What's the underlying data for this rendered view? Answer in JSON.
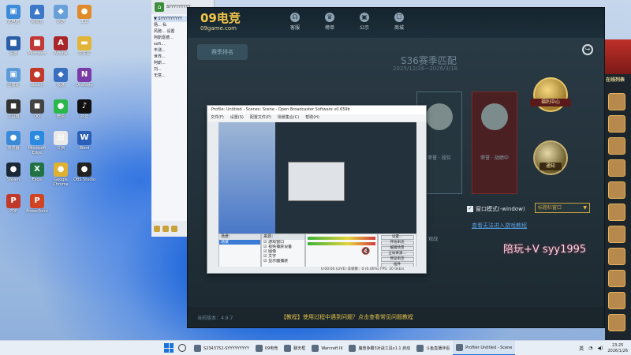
{
  "desktop": {
    "icons": [
      {
        "label": "此电脑",
        "color": "#3c8ad8",
        "glyph": "▣"
      },
      {
        "label": "网易云",
        "color": "#3c78c8",
        "glyph": "▲"
      },
      {
        "label": "驱动",
        "color": "#6aa0d8",
        "glyph": "◆"
      },
      {
        "label": "工具",
        "color": "#e08a2a",
        "glyph": "●"
      },
      {
        "label": "设置",
        "color": "#2a5fa8",
        "glyph": "■"
      },
      {
        "label": "Microsoft",
        "color": "#c03838",
        "glyph": "■"
      },
      {
        "label": "Access",
        "color": "#a8262a",
        "glyph": "A"
      },
      {
        "label": "文件夹",
        "color": "#e2b53a",
        "glyph": "▬"
      },
      {
        "label": "回收站",
        "color": "#5c9ad8",
        "glyph": "▣"
      },
      {
        "label": "Steam",
        "color": "#c0392b",
        "glyph": "●"
      },
      {
        "label": "极速",
        "color": "#3a6fc0",
        "glyph": "◆"
      },
      {
        "label": "OneNote",
        "color": "#7a3aa8",
        "glyph": "N"
      },
      {
        "label": "工具箱",
        "color": "#333333",
        "glyph": "◼"
      },
      {
        "label": "QQ",
        "color": "#444444",
        "glyph": "◼"
      },
      {
        "label": "微信",
        "color": "#2ab84a",
        "glyph": "●"
      },
      {
        "label": "抖音",
        "color": "#111111",
        "glyph": "♪"
      },
      {
        "label": "浏览器",
        "color": "#3a8ad8",
        "glyph": "●"
      },
      {
        "label": "Microsoft Edge",
        "color": "#2a8ae0",
        "glyph": "e"
      },
      {
        "label": "文档",
        "color": "#eaeaea",
        "glyph": "▤"
      },
      {
        "label": "Word",
        "color": "#2a5fb8",
        "glyph": "W"
      },
      {
        "label": "Steam",
        "color": "#1b2838",
        "glyph": "●"
      },
      {
        "label": "Excel",
        "color": "#217346",
        "glyph": "X"
      },
      {
        "label": "Google Chrome",
        "color": "#e0b030",
        "glyph": "●"
      },
      {
        "label": "OBS Studio",
        "color": "#222222",
        "glyph": "●"
      },
      {
        "label": "PDF",
        "color": "#c0392b",
        "glyph": "P"
      },
      {
        "label": "PowerPoint",
        "color": "#d04423",
        "glyph": "P"
      }
    ]
  },
  "chat": {
    "window_title": "SYYYYYYYYY",
    "items": [
      "▼ SYYYYYYYYY",
      "杨... 私",
      "风驰... 设置",
      "阿斯嘉德...",
      "soft...",
      "丰测...",
      "世界...",
      "阿斯...",
      "刘...",
      "无意..."
    ]
  },
  "game": {
    "logo": "09电竞",
    "logo_sub": "09game.com",
    "nav": [
      {
        "label": "客服",
        "icon": "headset-icon",
        "glyph": "☊"
      },
      {
        "label": "榜单",
        "icon": "trophy-icon",
        "glyph": "♛"
      },
      {
        "label": "公示",
        "icon": "notice-icon",
        "glyph": "▣"
      },
      {
        "label": "商城",
        "icon": "cart-icon",
        "glyph": "☐"
      }
    ],
    "season_badge": "赛季排名",
    "season_title": "S36赛季匹配",
    "season_date": "2025/12/26~2026/3/18",
    "welfare_label": "福利中心",
    "notice_label": "通知",
    "card_texts": [
      "荣誉 · 段位",
      "荣誉 · 战绩中"
    ],
    "window_mode": "窗口模式(-window)",
    "window_mode_checked": "✓",
    "window_select": "标题栏窗口",
    "tutorial_link": "查看无法进入游戏教程",
    "tab_watch": "观战",
    "version": "当前版本：4.9.7",
    "tutorial_banner": "【教程】使用过程中遇到问题？点击查看常见问题教程",
    "watermark": "陪玩+V syy1995"
  },
  "online": {
    "label": "在线列表"
  },
  "obs": {
    "title": "Profile: Untitled - Scenes: Scene - Open Broadcaster Software v0.659b",
    "menu": [
      "文件(F)",
      "设置(S)",
      "配置文件(P)",
      "场景集合(C)",
      "帮助(H)"
    ],
    "scenes_header": "场景：",
    "scenes": [
      "场景"
    ],
    "sources_header": "来源：",
    "sources": [
      "游戏窗口",
      "视频捕获设备",
      "图像",
      "文字",
      "显示器捕获"
    ],
    "buttons": [
      "设置...",
      "开始串流",
      "编辑场景",
      "全局来源...",
      "预览串流",
      "插件",
      "退出"
    ],
    "status": "0:00:00 (LIVE)   丢帧数：0 (0.00%)   FPS: 30   0kb/s"
  },
  "taskbar": {
    "items": [
      {
        "label": "S2343752-SYYYYYYYYY"
      },
      {
        "label": "09电竞"
      },
      {
        "label": "聊天框"
      },
      {
        "label": "Warcraft III"
      },
      {
        "label": "魔兽争霸3对战工具v1.1 启动"
      },
      {
        "label": "斗鱼直播伴侣"
      },
      {
        "label": "Profiler Untitled - Scene"
      }
    ],
    "lang": "英",
    "time": "23:25",
    "date": "2026/1/26"
  }
}
